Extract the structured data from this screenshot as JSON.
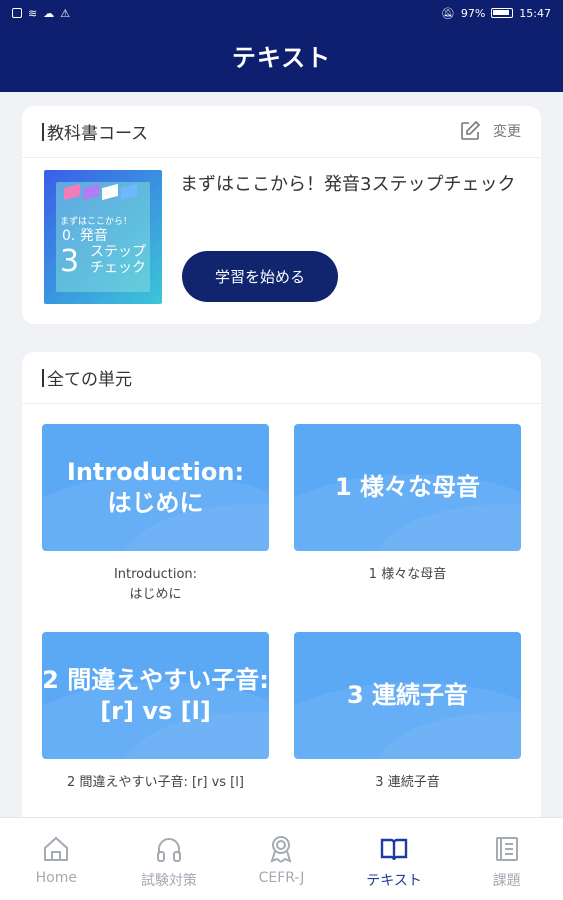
{
  "status_bar": {
    "battery": "97%",
    "time": "15:47"
  },
  "header": {
    "title": "テキスト"
  },
  "course_card": {
    "heading": "教科書コース",
    "change_label": "変更",
    "course_title": "まずはここから！発音3ステップチェック",
    "start_button": "学習を始める",
    "thumb": {
      "line1": "まずはここから！",
      "line2": "発音",
      "line3": "ステップ",
      "line4": "チェック",
      "big": "3",
      "small_num": "0."
    }
  },
  "units_card": {
    "heading": "全ての単元",
    "units": [
      {
        "tile": "Introduction:\nはじめに",
        "caption": "Introduction:\nはじめに"
      },
      {
        "tile": "1 様々な母音",
        "caption": "1 様々な母音"
      },
      {
        "tile": "2 間違えやすい子音:\n[r] vs [l]",
        "caption": "2 間違えやすい子音: [r] vs [l]"
      },
      {
        "tile": "3 連続子音",
        "caption": "3 連続子音"
      }
    ]
  },
  "tabbar": {
    "items": [
      {
        "label": "Home",
        "icon": "home-icon"
      },
      {
        "label": "試験対策",
        "icon": "headphones-icon"
      },
      {
        "label": "CEFR-J",
        "icon": "award-icon"
      },
      {
        "label": "テキスト",
        "icon": "book-icon",
        "active": true
      },
      {
        "label": "課題",
        "icon": "assignment-icon"
      }
    ]
  },
  "colors": {
    "header": "#0d1f6e",
    "tile": "#5ba8f5",
    "button": "#10256e",
    "tab_active": "#1f3b9e",
    "tab_inactive": "#a5aab3"
  }
}
